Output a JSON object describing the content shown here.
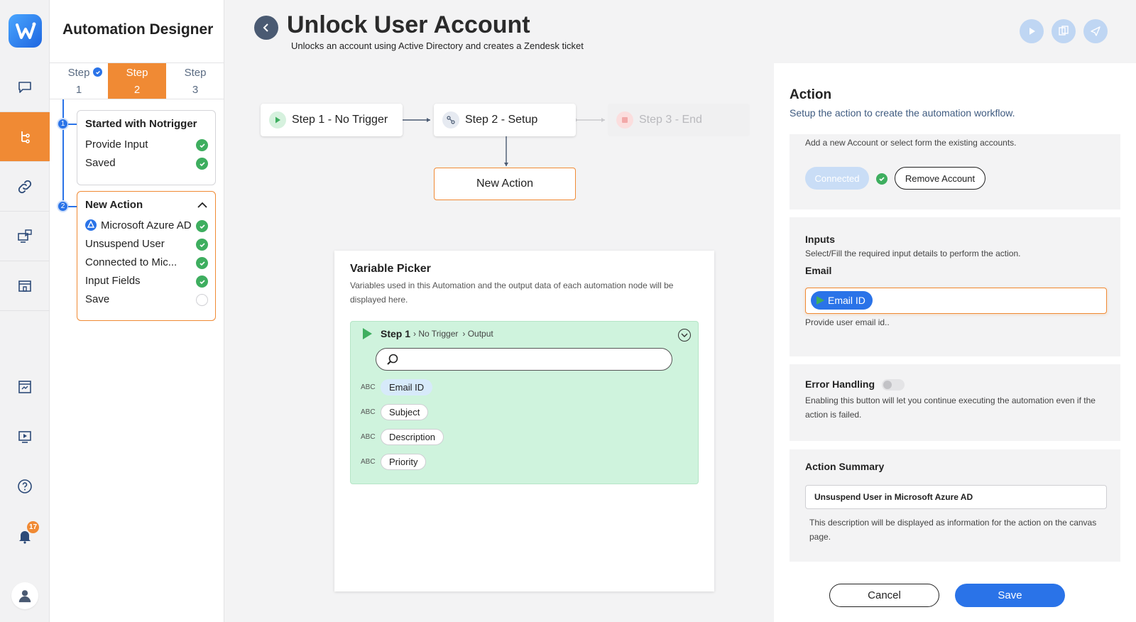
{
  "app": {
    "title": "Automation Designer"
  },
  "rail": {
    "notification_count": "17"
  },
  "steps_tabs": [
    {
      "word": "Step",
      "num": "1"
    },
    {
      "word": "Step",
      "num": "2"
    },
    {
      "word": "Step",
      "num": "3"
    }
  ],
  "step_cards": {
    "started": {
      "title": "Started with Notrigger",
      "items": [
        "Provide Input",
        "Saved"
      ]
    },
    "action": {
      "num": "2",
      "first_num": "1",
      "title": "New Action",
      "items": [
        "Microsoft Azure AD",
        "Unsuspend User",
        "Connected to Mic...",
        "Input Fields",
        "Save"
      ]
    }
  },
  "header": {
    "title": "Unlock User Account",
    "subtitle": "Unlocks an account using Active Directory and creates a Zendesk ticket"
  },
  "flow": {
    "step1": "Step 1 - No Trigger",
    "step2": "Step 2 - Setup",
    "step3": "Step 3 - End",
    "new_action": "New Action"
  },
  "variable_picker": {
    "title": "Variable Picker",
    "description": "Variables used in this Automation and the output data of each automation node will be displayed here.",
    "step_label": "Step 1",
    "crumb1": "› No Trigger",
    "crumb2": "› Output",
    "search_placeholder": "",
    "type_label": "ABC",
    "variables": [
      "Email ID",
      "Subject",
      "Description",
      "Priority"
    ]
  },
  "action_panel": {
    "title": "Action",
    "subtitle": "Setup the action to create the automation workflow.",
    "account": {
      "hint": "Add a new Account or select form the existing accounts.",
      "connected_label": "Connected",
      "remove_label": "Remove Account"
    },
    "inputs": {
      "title": "Inputs",
      "hint": "Select/Fill the required input details to perform the action.",
      "email_label": "Email",
      "email_chip": "Email ID",
      "email_help": "Provide user email id.."
    },
    "error_handling": {
      "title": "Error Handling",
      "enabled": false,
      "hint": "Enabling this button will let you continue executing the automation even if the action is failed."
    },
    "summary": {
      "title": "Action Summary",
      "value": "Unsuspend User in Microsoft Azure AD",
      "hint": "This description will be displayed as information for the action on the canvas page."
    },
    "cancel_label": "Cancel",
    "save_label": "Save"
  },
  "colors": {
    "accent": "#f08a34",
    "primary": "#2a73e8",
    "success": "#3eae5f",
    "picker_bg": "#cff3dd"
  }
}
